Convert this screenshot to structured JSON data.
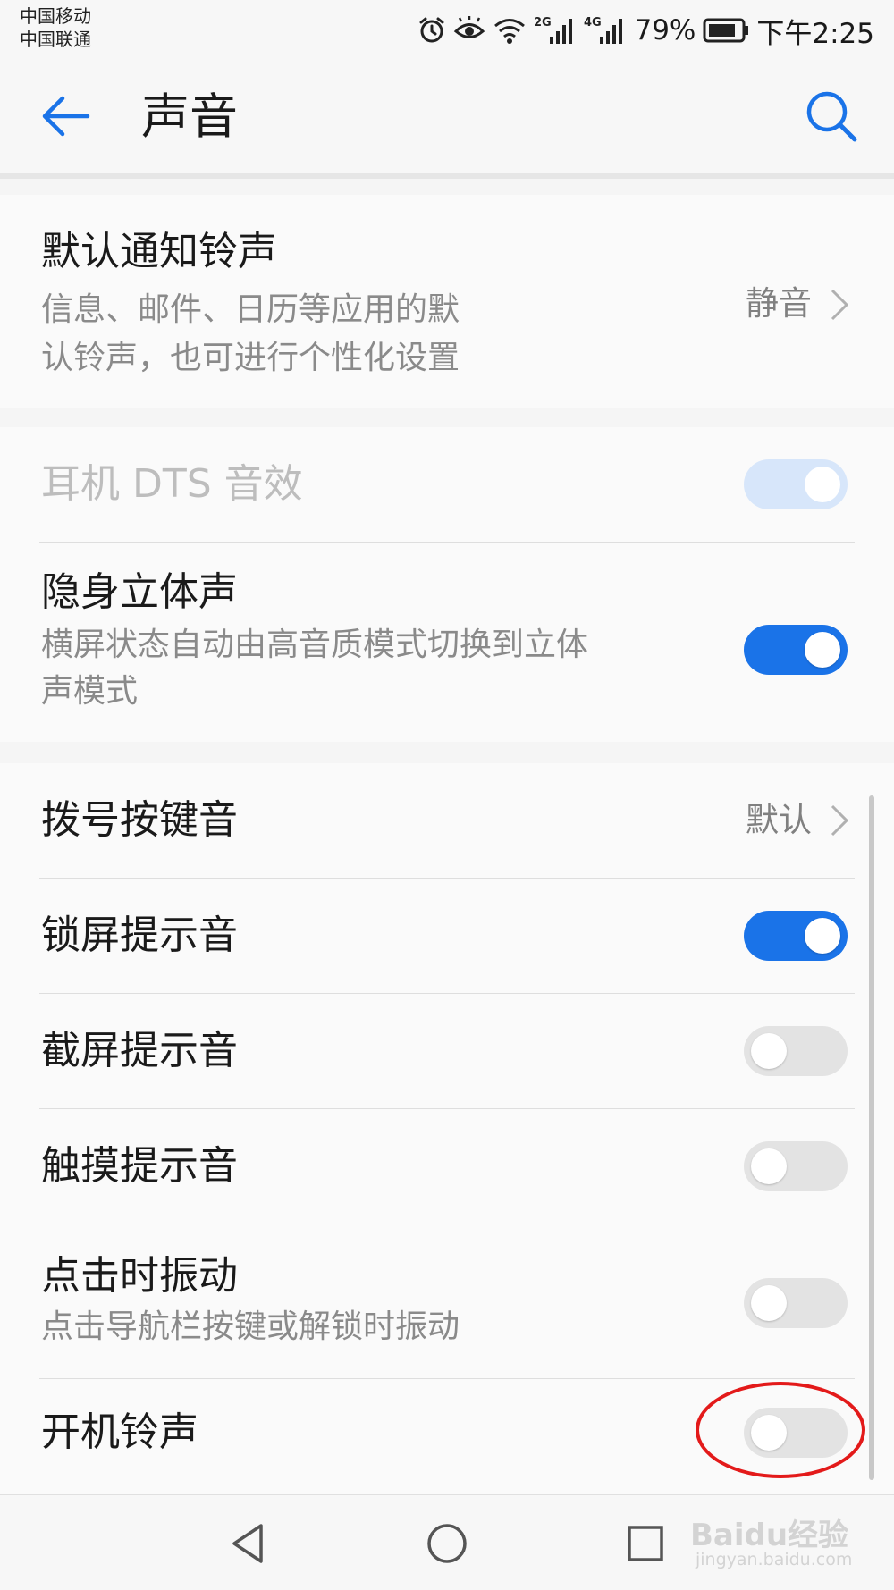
{
  "status_bar": {
    "carrier1": "中国移动",
    "carrier2": "中国联通",
    "signal1_label": "2G",
    "signal2_label": "4G",
    "battery": "79%",
    "time": "下午2:25",
    "icons": [
      "alarm-icon",
      "eye-comfort-icon",
      "wifi-icon",
      "signal-icon",
      "signal-icon",
      "battery-icon"
    ]
  },
  "app_bar": {
    "title": "声音",
    "back_icon": "arrow-left-icon",
    "search_icon": "search-icon"
  },
  "colors": {
    "accent": "#1a73e8",
    "toggle_off": "#e3e3e3",
    "highlight": "#e31a1a"
  },
  "settings": {
    "notification_tone": {
      "title": "默认通知铃声",
      "subtitle_line1": "信息、邮件、日历等应用的默",
      "subtitle_line2": "认铃声，也可进行个性化设置",
      "value": "静音"
    },
    "dts": {
      "title": "耳机 DTS 音效",
      "state": "on-disabled"
    },
    "stealth_stereo": {
      "title": "隐身立体声",
      "subtitle_line1": "横屏状态自动由高音质模式切换到立体",
      "subtitle_line2": "声模式",
      "state": "on"
    },
    "dial_tone": {
      "title": "拨号按键音",
      "value": "默认"
    },
    "lock_screen_sound": {
      "title": "锁屏提示音",
      "state": "on"
    },
    "screenshot_sound": {
      "title": "截屏提示音",
      "state": "off"
    },
    "touch_sound": {
      "title": "触摸提示音",
      "state": "off"
    },
    "vibrate_on_tap": {
      "title": "点击时振动",
      "subtitle": "点击导航栏按键或解锁时振动",
      "state": "off"
    },
    "boot_ringtone": {
      "title": "开机铃声",
      "state": "off"
    }
  },
  "nav_bar": {
    "back_icon": "triangle-back-icon",
    "home_icon": "circle-home-icon",
    "recents_icon": "square-recents-icon"
  },
  "watermark": {
    "logo": "Baidu经验",
    "url": "jingyan.baidu.com"
  }
}
